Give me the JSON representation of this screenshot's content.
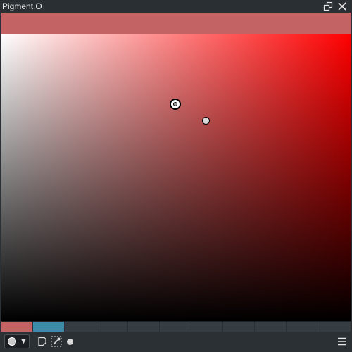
{
  "window": {
    "title": "Pigment.O"
  },
  "titlebar_icons": {
    "restore": "restore-window-icon",
    "close": "close-icon"
  },
  "colors": {
    "current": "#c46363",
    "hue": "#ff0000",
    "palette": [
      "#c46363",
      "#3d8aab",
      "#353c42",
      "#353c42",
      "#353c42",
      "#353c42",
      "#353c42",
      "#353c42",
      "#353c42",
      "#353c42",
      "#353c42"
    ]
  },
  "toolbar": {
    "mode_icon": "circle-panel-icon",
    "mode_arrow": "▼",
    "new_icon": "new-document-icon",
    "picker_icon": "eyedropper-icon",
    "dot_icon": "dot-icon",
    "menu_icon": "hamburger-menu-icon"
  }
}
